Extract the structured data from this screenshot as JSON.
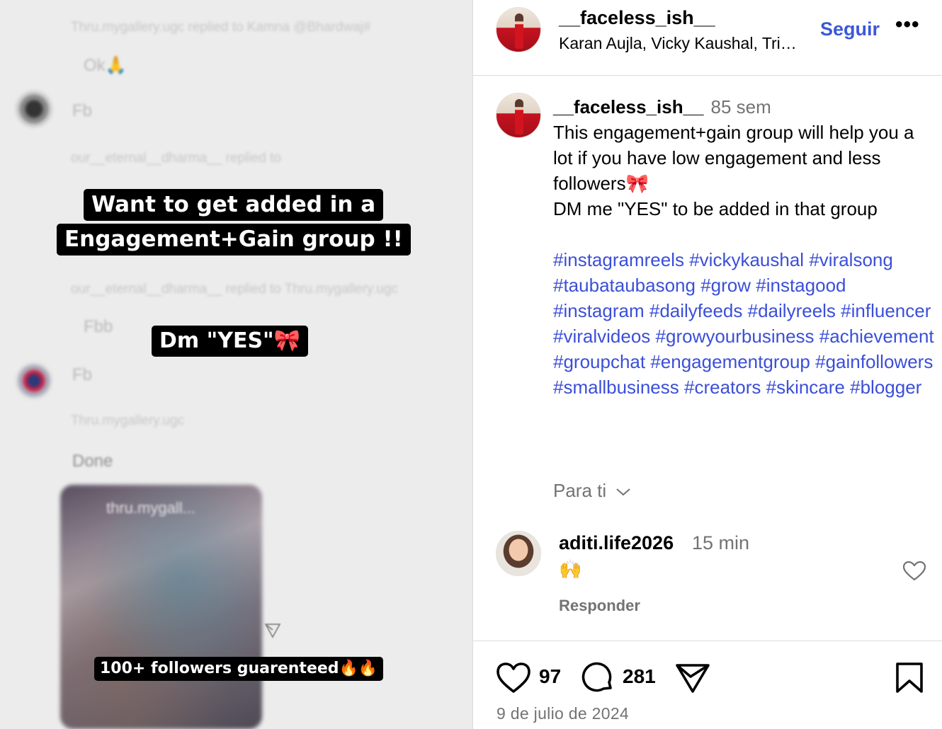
{
  "media": {
    "ghost_lines": [
      "Thru.mygallery.ugc replied to Kamna @Bhardwaj#",
      "Ok🙏",
      "Fb",
      "our__eternal__dharma__ replied to",
      "our__eternal__dharma__ replied to Thru.mygallery.ugc",
      "Fbb",
      "Fb",
      "Thru.mygallery.ugc",
      "Done",
      "thru.mygall..."
    ],
    "caption_line1": "Want to get added in a",
    "caption_line2": "Engagement+Gain group !!",
    "caption_dm": "Dm \"YES\"🎀",
    "caption_followers": "100+ followers guarenteed🔥🔥"
  },
  "header": {
    "username": "__faceless_ish__",
    "audio": "Karan Aujla, Vicky Kaushal, Tri…",
    "follow_label": "Seguir",
    "more_label": "•••"
  },
  "caption": {
    "username": "__faceless_ish__",
    "time": "85 sem",
    "text": "This engagement+gain group will help you a lot if you have low engagement and less followers🎀\nDM me \"YES\" to be added in that group",
    "hashtags": [
      "#instagramreels",
      "#vickykaushal",
      "#viralsong",
      "#taubataubasong",
      "#grow",
      "#instagood",
      "#instagram",
      "#dailyfeeds",
      "#dailyreels",
      "#influencer",
      "#viralvideos",
      "#growyourbusiness",
      "#achievement",
      "#groupchat",
      "#engagementgroup",
      "#gainfollowers",
      "#smallbusiness",
      "#creators",
      "#skincare",
      "#blogger"
    ]
  },
  "for_you_label": "Para ti",
  "comment": {
    "username": "aditi.life2026",
    "time": "15 min",
    "text": "🙌",
    "reply_label": "Responder"
  },
  "footer": {
    "likes": "97",
    "comments": "281",
    "date": "9 de julio de 2024"
  },
  "icons": {
    "like": "heart-icon",
    "comment": "speech-bubble-icon",
    "share": "paper-plane-icon",
    "save": "bookmark-icon",
    "chevron": "chevron-down-icon"
  },
  "colors": {
    "link": "#3b58d9",
    "hashtag": "#3b4fd8",
    "muted": "#737373",
    "divider": "#dbdbdb"
  }
}
